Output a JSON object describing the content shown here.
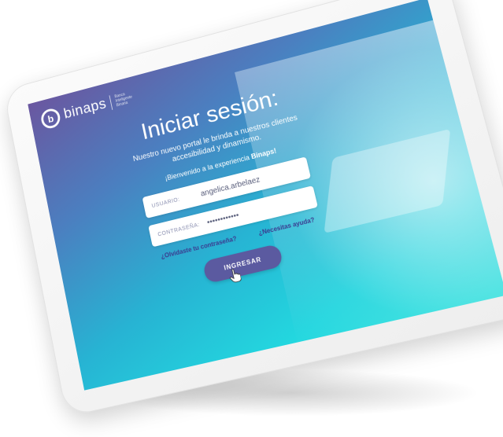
{
  "brand": {
    "logo_letter": "b",
    "name": "binaps",
    "tagline": [
      "Banca",
      "Inteligente",
      "Binaria"
    ]
  },
  "login": {
    "title": "Iniciar sesión:",
    "description": "Nuestro nuevo portal le brinda a nuestros clientes accesibilidad y dinamismo.",
    "welcome_prefix": "¡Bienvenido a la experiencia ",
    "welcome_brand": "Binaps!",
    "username_label": "USUARIO:",
    "username_value": "angelica.arbelaez",
    "password_label": "CONTRASEÑA:",
    "password_value": "••••••••••••",
    "forgot_link": "¿Olvidaste tu contraseña?",
    "help_link": "¿Necesitas ayuda?",
    "submit_label": "INGRESAR"
  },
  "colors": {
    "gradient_top": "#6a57a0",
    "gradient_bottom": "#23d7df",
    "button": "#5b5aa0",
    "link": "#3b3a8f"
  },
  "icons": [
    "hand-pointer-cursor-icon"
  ]
}
